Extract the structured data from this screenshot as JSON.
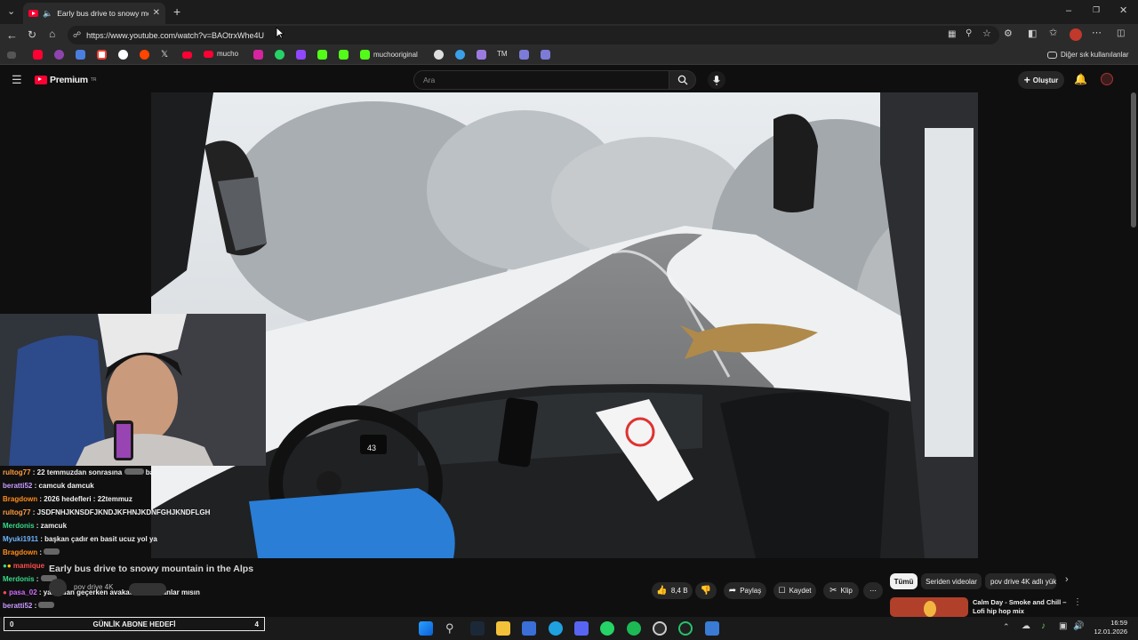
{
  "browser": {
    "tab_title": "Early bus drive to snowy mou",
    "url": "https://www.youtube.com/watch?v=BAOtrxWhe4U",
    "bookmarks": [
      {
        "label": "mucho"
      },
      {
        "label": "muchooriginal"
      },
      {
        "label": "TM"
      }
    ],
    "other_bookmarks": "Diğer sık kullanılanlar"
  },
  "youtube": {
    "logo_text": "Premium",
    "logo_region": "TR",
    "search_placeholder": "Ara",
    "create_label": "Oluştur",
    "video_title": "Early bus drive to snowy mountain in the Alps",
    "channel": "pov drive 4K",
    "likes": "8,4 B",
    "share_label": "Paylaş",
    "save_label": "Kaydet",
    "clip_label": "Klip",
    "chips": [
      "Tümü",
      "Seriden videolar",
      "pov drive 4K adlı yükl"
    ],
    "recommended": {
      "title_line1": "Calm Day - Smoke and Chill –",
      "title_line2": "Lofi hip hop mix"
    },
    "dashboard_speed": "43"
  },
  "stream_overlay": {
    "chat": [
      {
        "user": "rultog77",
        "color": "#ff9b3d",
        "text": "22 temmuzdan sonrasına",
        "text2": "bakarız"
      },
      {
        "user": "beratti52",
        "color": "#c99dff",
        "text": "camcuk damcuk"
      },
      {
        "user": "Bragdown",
        "color": "#ff8c1a",
        "text": "2026 hedefleri : 22temmuz"
      },
      {
        "user": "rultog77",
        "color": "#ff9b3d",
        "text": "JSDFNHJKNSDFJKNDJKFHNJKDNFGHJKNDFLGH"
      },
      {
        "user": "Merdonis",
        "color": "#39d98a",
        "text": "zamcuk"
      },
      {
        "user": "Myuki1911",
        "color": "#6fb6ff",
        "text": "başkan çadır en basit ucuz yol ya"
      },
      {
        "user": "Bragdown",
        "color": "#ff8c1a",
        "text": ""
      },
      {
        "user": "mamique",
        "color": "#ff4d4d",
        "text": ""
      },
      {
        "user": "Merdonis",
        "color": "#39d98a",
        "text": ""
      },
      {
        "user": "pasa_02",
        "color": "#d26bff",
        "text": "yanından geçerken avakado desek anlar mısın"
      },
      {
        "user": "beratti52",
        "color": "#c99dff",
        "text": ""
      }
    ],
    "goal_label": "GÜNLİK ABONE HEDEFİ",
    "goal_current": "0",
    "goal_target": "4"
  },
  "taskbar": {
    "time": "16:59",
    "date": "12.01.2026"
  },
  "colors": {
    "yt_red": "#ff0033",
    "bg": "#0f0f0f"
  }
}
